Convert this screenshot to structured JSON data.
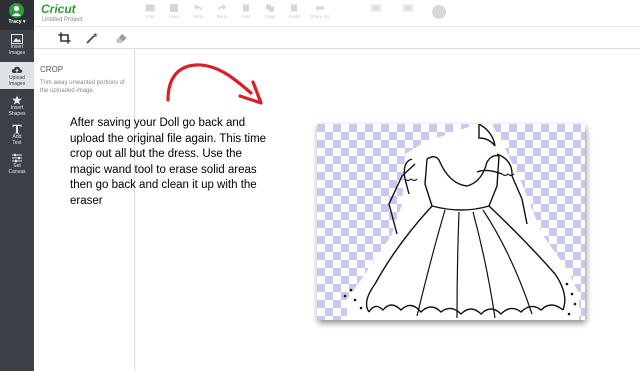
{
  "header": {
    "logo": "Cricut",
    "project_title": "Untitled Project"
  },
  "sidebar": {
    "user_name": "Tracy ▾",
    "items": [
      {
        "line1": "Insert",
        "line2": "Images"
      },
      {
        "line1": "Upload",
        "line2": "Images"
      },
      {
        "line1": "Insert",
        "line2": "Shapes"
      },
      {
        "line1": "Add",
        "line2": "Text"
      },
      {
        "line1": "Set",
        "line2": "Canvas"
      }
    ]
  },
  "toolbar": {
    "buttons": [
      "Fore",
      "Save",
      "Undo",
      "Redo",
      "Edit",
      "Copy",
      "Paste",
      "Share SS",
      "",
      "",
      ""
    ]
  },
  "panel": {
    "title": "CROP",
    "description": "Trim away unwanted portions of the uploaded image."
  },
  "overlay": {
    "instructions": "After saving your Doll go back and upload the original file again. This time crop out all but the dress. Use the magic wand tool to erase solid areas then go back and clean it up with the eraser"
  },
  "colors": {
    "sidebar_bg": "#3b4046",
    "brand_green": "#2f9c3a",
    "annotation_red": "#d8202a",
    "transparency_check": "#c8c8f0"
  }
}
